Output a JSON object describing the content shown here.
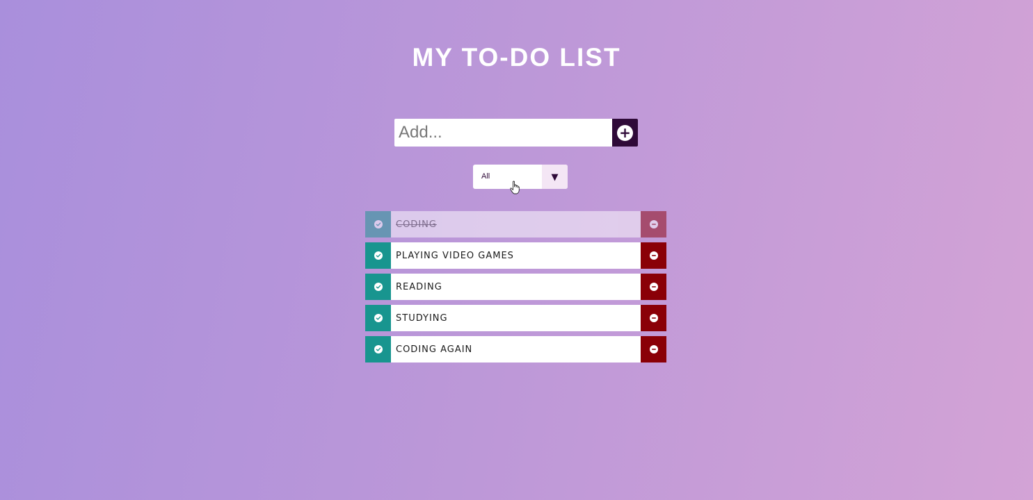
{
  "header": {
    "title": "MY TO-DO LIST"
  },
  "add_form": {
    "placeholder": "Add...",
    "add_icon": "plus-icon"
  },
  "filter": {
    "selected": "All",
    "arrow": "▼"
  },
  "todos": [
    {
      "text": "CODING",
      "completed": true
    },
    {
      "text": "PLAYING VIDEO GAMES",
      "completed": false
    },
    {
      "text": "READING",
      "completed": false
    },
    {
      "text": "STUDYING",
      "completed": false
    },
    {
      "text": "CODING AGAIN",
      "completed": false
    }
  ],
  "colors": {
    "background_start": "#a98fdc",
    "background_end": "#d3a3d6",
    "add_button": "#2f0a38",
    "complete_button": "#18958f",
    "delete_button": "#8a0007"
  }
}
